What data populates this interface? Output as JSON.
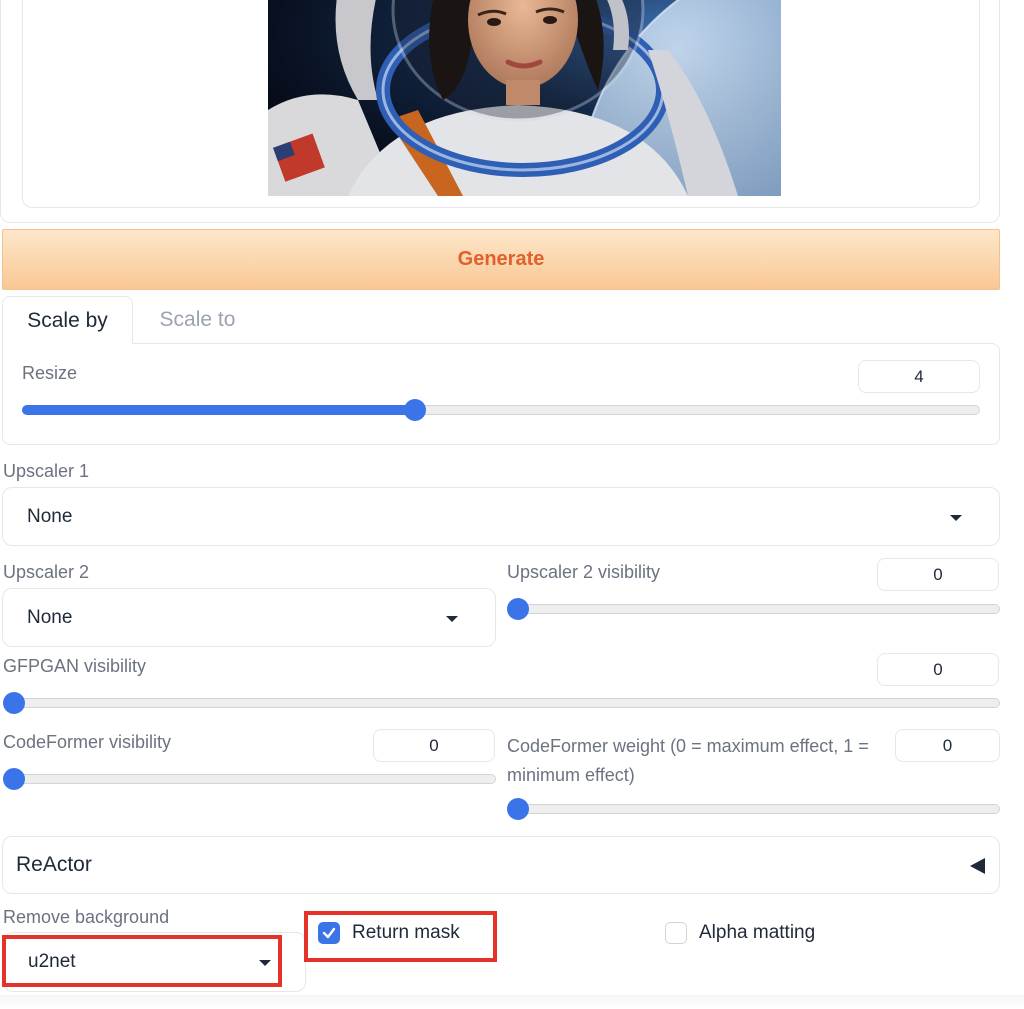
{
  "generate_label": "Generate",
  "tabs": [
    {
      "label": "Scale by",
      "active": true
    },
    {
      "label": "Scale to",
      "active": false
    }
  ],
  "resize": {
    "label": "Resize",
    "value": "4",
    "fraction": 0.41
  },
  "upscaler1": {
    "label": "Upscaler 1",
    "selected": "None"
  },
  "upscaler2": {
    "label": "Upscaler 2",
    "selected": "None"
  },
  "upscaler2_visibility": {
    "label": "Upscaler 2 visibility",
    "value": "0",
    "fraction": 0
  },
  "gfpgan_visibility": {
    "label": "GFPGAN visibility",
    "value": "0",
    "fraction": 0
  },
  "codeformer_visibility": {
    "label": "CodeFormer visibility",
    "value": "0",
    "fraction": 0
  },
  "codeformer_weight": {
    "label": "CodeFormer weight (0 = maximum effect, 1 = minimum effect)",
    "value": "0",
    "fraction": 0
  },
  "reactor": {
    "label": "ReActor"
  },
  "remove_background": {
    "label": "Remove background",
    "selected": "u2net"
  },
  "return_mask": {
    "label": "Return mask",
    "checked": true
  },
  "alpha_matting": {
    "label": "Alpha matting",
    "checked": false
  },
  "colors": {
    "accent": "#3b74e8",
    "generate_text": "#e0622a",
    "highlight": "#e5332a"
  }
}
